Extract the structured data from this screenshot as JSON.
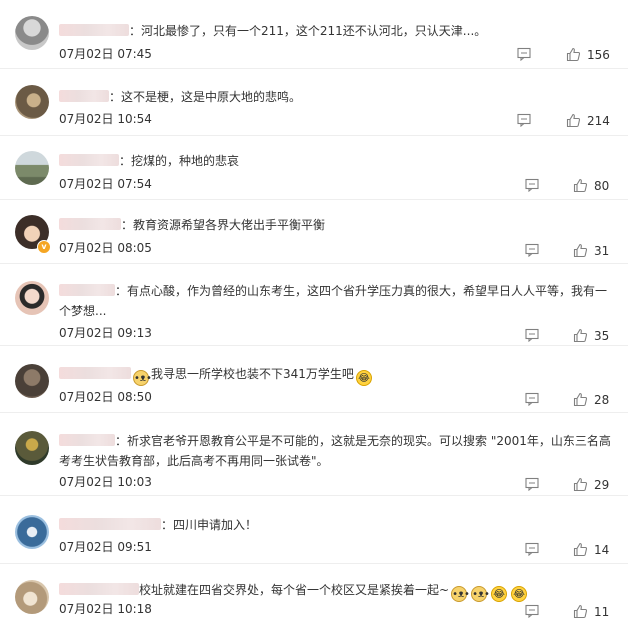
{
  "comments": [
    {
      "text": "：河北最惨了，只有一个211，这个211还不认河北，只认天津...。",
      "date": "07月02日 07:45",
      "likes": "156",
      "avatar_color": "#8a8a8a"
    },
    {
      "text": "：这不是梗，这是中原大地的悲鸣。",
      "date": "07月02日 10:54",
      "likes": "214",
      "avatar_color": "#6b5a45"
    },
    {
      "text": "：挖煤的，种地的悲哀",
      "date": "07月02日 07:54",
      "likes": "80",
      "avatar_color": "#7c8a6a"
    },
    {
      "text": "：教育资源希望各界大佬出手平衡平衡",
      "date": "07月02日 08:05",
      "likes": "31",
      "avatar_color": "#3c2e28"
    },
    {
      "text": "：有点心酸，作为曾经的山东考生，这四个省升学压力真的很大，希望早日人人平等，我有一个梦想...",
      "date": "07月02日 09:13",
      "likes": "35",
      "avatar_color": "#d9b3a3"
    },
    {
      "text": "我寻思一所学校也装不下341万学生吧",
      "date": "07月02日 08:50",
      "likes": "28",
      "avatar_color": "#4a4038"
    },
    {
      "text": "：祈求官老爷开恩教育公平是不可能的，这就是无奈的现实。可以搜索 \"2001年，山东三名高考考生状告教育部，此后高考不再用同一张试卷\"。",
      "date": "07月02日 10:03",
      "likes": "29",
      "avatar_color": "#5a5a3a"
    },
    {
      "text": "：四川申请加入！",
      "date": "07月02日 09:51",
      "likes": "14",
      "avatar_color": "#3a6b9a"
    },
    {
      "text": "校址就建在四省交界处，每个省一个校区又是紧挨着一起~",
      "date": "07月02日 10:18",
      "likes": "11",
      "avatar_color": "#b39a7a"
    }
  ],
  "icons": {
    "reply": "comment-icon",
    "like": "thumbs-up-icon",
    "emoji_cry": "cry-laugh-emoji",
    "emoji_doge": "doge-emoji"
  },
  "colors": {
    "text": "#333333",
    "divider": "#eeeeee",
    "icon": "#808080",
    "verified_badge": "#f5a623"
  }
}
